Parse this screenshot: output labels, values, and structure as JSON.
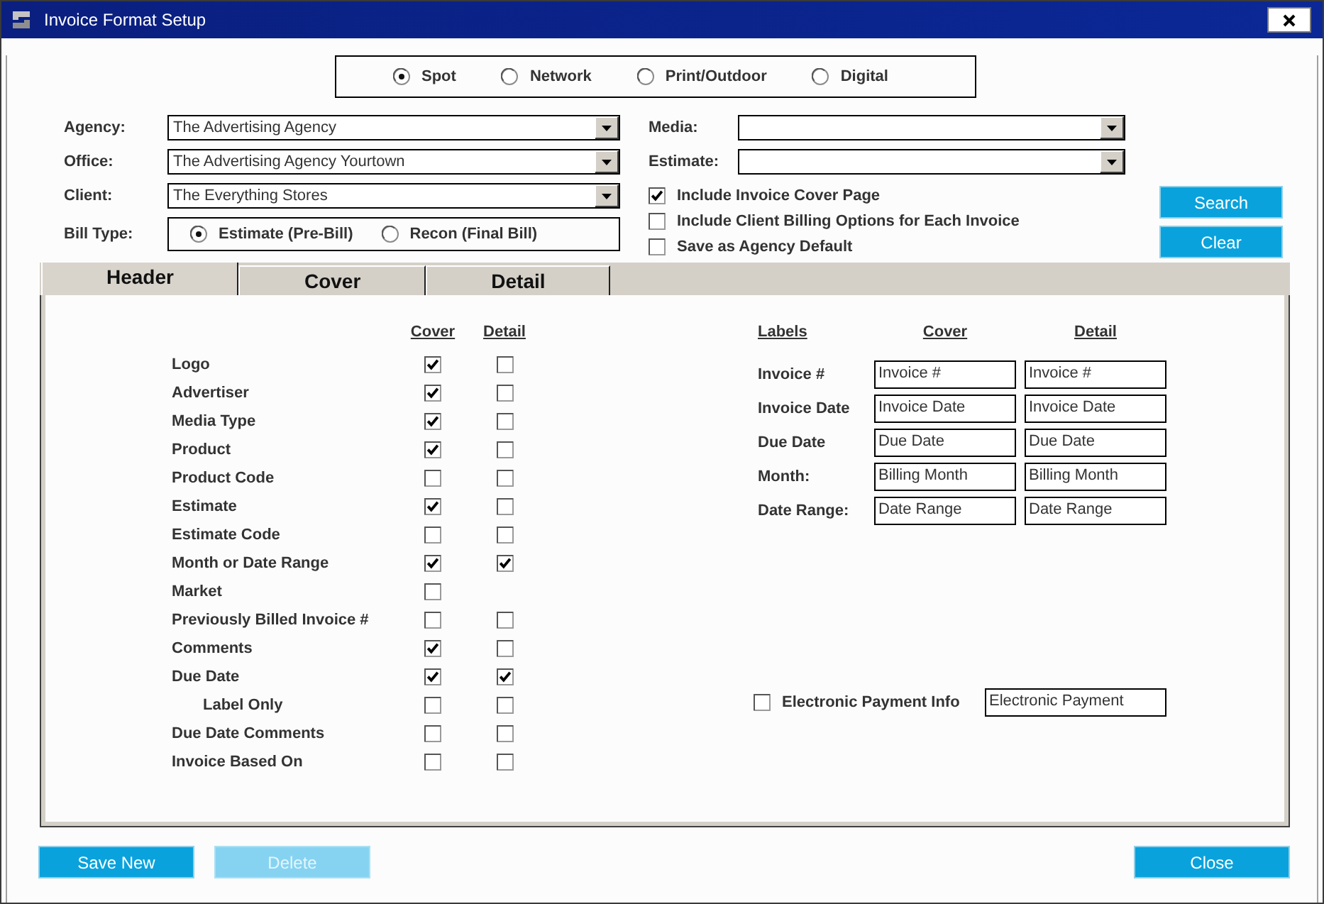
{
  "window": {
    "title": "Invoice Format Setup"
  },
  "media_types": [
    {
      "label": "Spot",
      "selected": true
    },
    {
      "label": "Network",
      "selected": false
    },
    {
      "label": "Print/Outdoor",
      "selected": false
    },
    {
      "label": "Digital",
      "selected": false
    }
  ],
  "filters": [
    {
      "label": "Agency:",
      "value": "The Advertising Agency"
    },
    {
      "label": "Office:",
      "value": "The Advertising Agency Yourtown"
    },
    {
      "label": "Client:",
      "value": "The Everything Stores"
    }
  ],
  "bill_type": {
    "label": "Bill Type:",
    "options": [
      {
        "label": "Estimate (Pre-Bill)",
        "selected": true
      },
      {
        "label": "Recon (Final Bill)",
        "selected": false
      }
    ]
  },
  "media_filters": [
    {
      "label": "Media:"
    },
    {
      "label": "Estimate:"
    }
  ],
  "options": [
    {
      "label": "Include Invoice Cover Page",
      "checked": true
    },
    {
      "label": "Include Client Billing Options for Each Invoice",
      "checked": false
    },
    {
      "label": "Save as Agency Default",
      "checked": false
    }
  ],
  "search_buttons": [
    "Search",
    "Clear"
  ],
  "tabs": [
    {
      "label": "Header",
      "selected": true
    },
    {
      "label": "Cover",
      "selected": false
    },
    {
      "label": "Detail",
      "selected": false
    }
  ],
  "header_fields": {
    "columns": [
      "Cover",
      "Detail"
    ],
    "items": [
      {
        "label": "Logo",
        "cover": true,
        "detail": false
      },
      {
        "label": "Advertiser",
        "cover": true,
        "detail": false
      },
      {
        "label": "Media Type",
        "cover": true,
        "detail": false
      },
      {
        "label": "Product",
        "cover": true,
        "detail": false
      },
      {
        "label": "Product Code",
        "cover": false,
        "detail": false
      },
      {
        "label": "Estimate",
        "cover": true,
        "detail": false
      },
      {
        "label": "Estimate Code",
        "cover": false,
        "detail": false
      },
      {
        "label": "Month or Date Range",
        "cover": true,
        "detail": true
      },
      {
        "label": "Market",
        "cover": false
      },
      {
        "label": "Previously Billed Invoice #",
        "cover": false,
        "detail": false
      },
      {
        "label": "Comments",
        "cover": true,
        "detail": false
      },
      {
        "label": "Due Date",
        "cover": true,
        "detail": true,
        "children": [
          {
            "label": "Label Only",
            "cover": false,
            "detail": false
          }
        ]
      },
      {
        "label": "Due Date Comments",
        "cover": false,
        "detail": false
      },
      {
        "label": "Invoice Based On",
        "cover": false,
        "detail": false
      }
    ]
  },
  "labels": {
    "columns": [
      "Labels",
      "Cover",
      "Detail"
    ],
    "rows": [
      {
        "label": "Invoice #",
        "cover": "Invoice #",
        "detail": "Invoice #"
      },
      {
        "label": "Invoice Date",
        "cover": "Invoice Date",
        "detail": "Invoice Date"
      },
      {
        "label": "Due Date",
        "cover": "Due Date",
        "detail": "Due Date"
      },
      {
        "label": "Month:",
        "cover": "Billing Month",
        "detail": "Billing Month"
      },
      {
        "label": "Date Range:",
        "cover": "Date Range",
        "detail": "Date Range"
      }
    ]
  },
  "electronic_payment": {
    "label": "Electronic Payment Info",
    "checked": false,
    "value": "Electronic Payment"
  },
  "footer_buttons": [
    {
      "label": "Save New",
      "disabled": false
    },
    {
      "label": "Delete",
      "disabled": true
    },
    {
      "label": "Close",
      "disabled": false
    }
  ]
}
